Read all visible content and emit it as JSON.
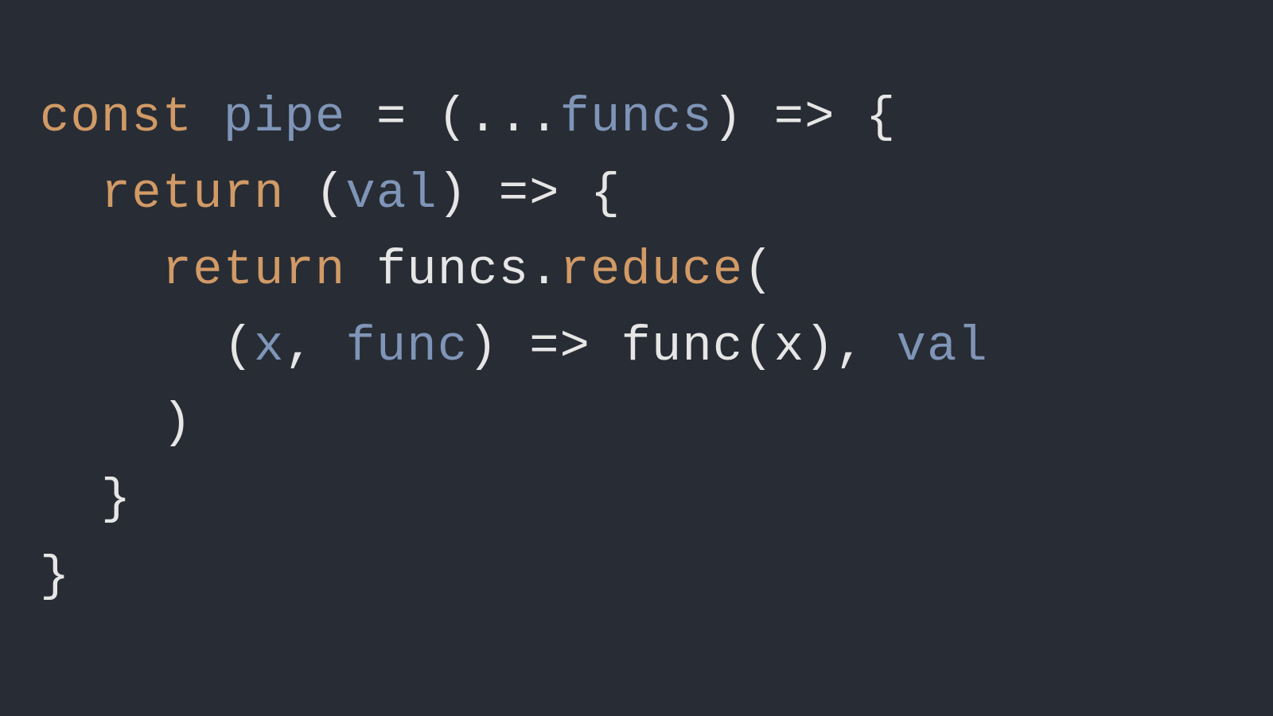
{
  "colors": {
    "background": "#282c34",
    "keyword": "#d19a66",
    "identifier": "#7f95b8",
    "method": "#d19a66",
    "default": "#e6e6e6"
  },
  "code": {
    "line1": {
      "t1": "const",
      "t2": " ",
      "t3": "pipe",
      "t4": " ",
      "t5": "=",
      "t6": " ",
      "t7": "(",
      "t8": "...",
      "t9": "funcs",
      "t10": ")",
      "t11": " ",
      "t12": "=>",
      "t13": " ",
      "t14": "{"
    },
    "line2": {
      "indent": "  ",
      "t1": "return",
      "t2": " ",
      "t3": "(",
      "t4": "val",
      "t5": ")",
      "t6": " ",
      "t7": "=>",
      "t8": " ",
      "t9": "{"
    },
    "line3": {
      "indent": "    ",
      "t1": "return",
      "t2": " ",
      "t3": "funcs",
      "t4": ".",
      "t5": "reduce",
      "t6": "("
    },
    "line4": {
      "indent": "      ",
      "t1": "(",
      "t2": "x",
      "t3": ",",
      "t4": " ",
      "t5": "func",
      "t6": ")",
      "t7": " ",
      "t8": "=>",
      "t9": " ",
      "t10": "func",
      "t11": "(",
      "t12": "x",
      "t13": ")",
      "t14": ",",
      "t15": " ",
      "t16": "val"
    },
    "line5": {
      "indent": "    ",
      "t1": ")"
    },
    "line6": {
      "indent": "  ",
      "t1": "}"
    },
    "line7": {
      "t1": "}"
    }
  }
}
